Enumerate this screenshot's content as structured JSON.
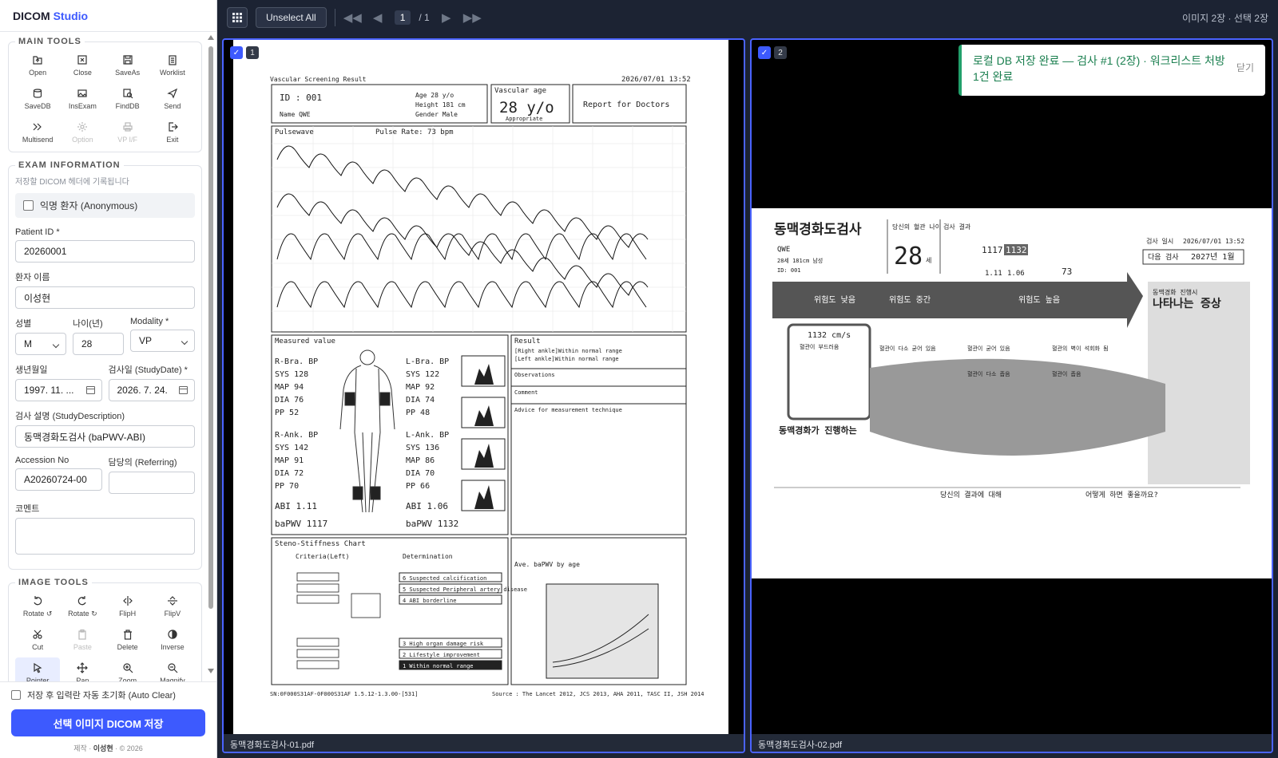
{
  "brand": {
    "part1": "DICOM",
    "part2": "Studio"
  },
  "main_tools": {
    "title": "MAIN TOOLS",
    "items": [
      {
        "label": "Open",
        "icon": "open-icon"
      },
      {
        "label": "Close",
        "icon": "close-file-icon"
      },
      {
        "label": "SaveAs",
        "icon": "save-icon"
      },
      {
        "label": "Worklist",
        "icon": "clipboard-icon"
      },
      {
        "label": "SaveDB",
        "icon": "database-icon"
      },
      {
        "label": "InsExam",
        "icon": "image-icon"
      },
      {
        "label": "FindDB",
        "icon": "search-db-icon"
      },
      {
        "label": "Send",
        "icon": "send-icon"
      },
      {
        "label": "Multisend",
        "icon": "multisend-icon"
      },
      {
        "label": "Option",
        "icon": "gear-icon"
      },
      {
        "label": "VP I/F",
        "icon": "printer-icon"
      },
      {
        "label": "Exit",
        "icon": "exit-icon"
      }
    ]
  },
  "exam_info": {
    "title": "EXAM INFORMATION",
    "hint": "저장할 DICOM 헤더에 기록됩니다",
    "anonymous_label": "익명 환자 (Anonymous)",
    "patient_id_label": "Patient ID *",
    "patient_id": "20260001",
    "name_label": "환자 이름",
    "name": "이성현",
    "sex_label": "성별",
    "sex": "M",
    "age_label": "나이(년)",
    "age": "28",
    "modality_label": "Modality *",
    "modality": "VP",
    "birth_label": "생년월일",
    "birth": "1997. 11. ...",
    "study_date_label": "검사일 (StudyDate) *",
    "study_date": "2026. 7. 24.",
    "desc_label": "검사 설명 (StudyDescription)",
    "desc": "동맥경화도검사 (baPWV-ABI)",
    "accession_label": "Accession No",
    "accession": "A20260724-00",
    "referring_label": "담당의 (Referring)",
    "referring": "",
    "comment_label": "코멘트",
    "comment": ""
  },
  "image_tools": {
    "title": "IMAGE TOOLS",
    "items": [
      {
        "label": "Rotate ↺",
        "icon": "rotate-left-icon"
      },
      {
        "label": "Rotate ↻",
        "icon": "rotate-right-icon"
      },
      {
        "label": "FlipH",
        "icon": "flip-h-icon"
      },
      {
        "label": "FlipV",
        "icon": "flip-v-icon"
      },
      {
        "label": "Cut",
        "icon": "scissors-icon"
      },
      {
        "label": "Paste",
        "icon": "paste-icon"
      },
      {
        "label": "Delete",
        "icon": "trash-icon"
      },
      {
        "label": "Inverse",
        "icon": "inverse-icon"
      },
      {
        "label": "Pointer",
        "icon": "pointer-icon"
      },
      {
        "label": "Pan",
        "icon": "pan-icon"
      },
      {
        "label": "Zoom",
        "icon": "zoom-icon"
      },
      {
        "label": "Magnify",
        "icon": "magnify-icon"
      }
    ]
  },
  "bottom": {
    "auto_clear": "저장 후 입력란 자동 초기화 (Auto Clear)",
    "save_button": "선택 이미지 DICOM 저장",
    "credit_prefix": "제작 · ",
    "credit_name": "이성현",
    "credit_suffix": " · © 2026"
  },
  "toolbar": {
    "unselect_all": "Unselect All",
    "page_current": "1",
    "page_total": "/ 1",
    "status": "이미지 2장 · 선택 2장"
  },
  "panes": [
    {
      "index": "1",
      "filename": "동맥경화도검사-01.pdf"
    },
    {
      "index": "2",
      "filename": "동맥경화도검사-02.pdf"
    }
  ],
  "toast": {
    "message": "로컬 DB 저장 완료 — 검사 #1 (2장) · 워크리스트 처방 1건 완료",
    "close": "닫기"
  },
  "report1": {
    "title": "Vascular Screening Result",
    "date": "2026/07/01 13:52",
    "id_line": "ID : 001",
    "name_line": "Name  QWE",
    "age_line": "Age  28 y/o",
    "height_line": "Height 181 cm",
    "gender_line": "Gender Male",
    "vascular_age_label": "Vascular age",
    "vascular_age": "28 y/o",
    "appropriate": "Appropriate",
    "doctors": "Report for Doctors",
    "pulsewave": "Pulsewave",
    "pulse_rate": "Pulse Rate: 73 bpm",
    "measured": "Measured value",
    "rbra": "R-Bra. BP",
    "lbra": "L-Bra. BP",
    "rank": "R-Ank. BP",
    "lank": "L-Ank. BP",
    "rbra_vals": [
      "SYS 128",
      "MAP 94",
      "DIA 76",
      "PP 52"
    ],
    "lbra_vals": [
      "SYS 122",
      "MAP 92",
      "DIA 74",
      "PP 48"
    ],
    "rank_vals": [
      "SYS 142",
      "MAP 91",
      "DIA 72",
      "PP 70"
    ],
    "lank_vals": [
      "SYS 136",
      "MAP 86",
      "DIA 70",
      "PP 66"
    ],
    "abi_r": "ABI 1.11",
    "abi_l": "ABI 1.06",
    "bapwv_r": "baPWV 1117",
    "bapwv_l": "baPWV 1132",
    "result": "Result",
    "result_r": "[Right ankle]Within normal range",
    "result_l": "[Left ankle]Within normal range",
    "observations": "Observations",
    "comment": "Comment",
    "advice": "Advice for measurement technique",
    "steno": "Steno-Stiffness Chart",
    "criteria": "Criteria(Left)",
    "determination": "Determination",
    "dets": [
      "6 Suspected calcification",
      "5 Suspected Peripheral artery disease",
      "4 ABI borderline",
      "3 High organ damage risk",
      "2 Lifestyle improvement",
      "1 Within normal range"
    ],
    "ave_title": "Ave. baPWV by age",
    "footer_left": "SN:0F000S31AF-0F000S31AF 1.5.12-1.3.00-[531]",
    "footer_right": "Source : The Lancet 2012, JCS 2013, AHA 2011, TASC II, JSH 2014"
  },
  "report2": {
    "title": "동맥경화도검사",
    "patient": "QWE",
    "patient_info": "28세 181cm 남성",
    "patient_id": "ID: 001",
    "age_label": "당신의 혈관 나이",
    "age": "28",
    "age_unit": "세",
    "results_label": "검사 결과",
    "bapwv_r": "1117",
    "bapwv_l": "1132",
    "abi_r": "1.11",
    "abi_l": "1.06",
    "pulse": "73",
    "exam_date_label": "검사 일시",
    "exam_date": "2026/07/01 13:52",
    "next_label": "다음 검사",
    "next": "2027년 1월",
    "risk_low": "위험도 낮음",
    "risk_mid": "위험도 중간",
    "risk_high": "위험도 높음",
    "symptoms": "나타나는 증상",
    "symptoms_sub": "동맥경화 진행시",
    "progress": "동맥경화가 진행하는",
    "value_display": "1132 cm/s",
    "stage1": "혈관이 부드러움",
    "stage2": "혈관이 다소 굳어 있음",
    "stage3": "혈관이 굳어 있음",
    "stage4": "혈관이 다소 좁음",
    "stage5": "혈관이 좁음",
    "stage6": "혈관의 벽이 석회화 됨",
    "your_result": "당신의 결과에 대해",
    "what_to_do": "어떻게 하면 좋을까요?"
  }
}
